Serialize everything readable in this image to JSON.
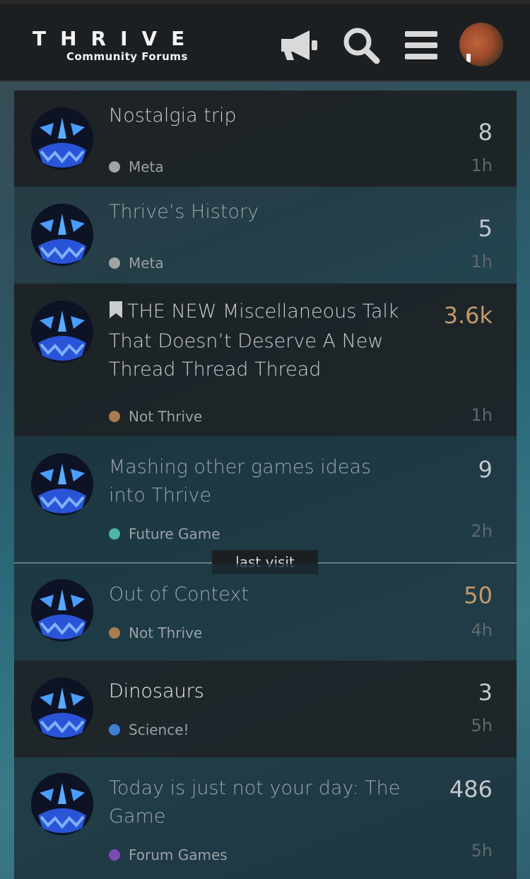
{
  "header": {
    "logo_main": "THRIVE",
    "logo_sub": "Community Forums",
    "icons": [
      "megaphone-icon",
      "search-icon",
      "hamburger-menu-icon",
      "user-avatar"
    ]
  },
  "colors": {
    "header_bg": "#1c1f22",
    "meta": "#a3a3a3",
    "not_thrive": "#a97c50",
    "future_game": "#4fb6a4",
    "science": "#3f7fd6",
    "forum_games": "#7d4bb3",
    "hot_count": "#c59a6a"
  },
  "topics": [
    {
      "title": "Nostalgia trip",
      "category": "Meta",
      "count": "8",
      "time": "1h"
    },
    {
      "title": "Thrive’s History",
      "category": "Meta",
      "count": "5",
      "time": "1h"
    },
    {
      "title": "THE NEW Miscellaneous Talk That Doesn’t Deserve A New Thread Thread Thread",
      "category": "Not Thrive",
      "count": "3.6k",
      "time": "1h"
    },
    {
      "title": "Mashing other games ideas into Thrive",
      "category": "Future Game",
      "count": "9",
      "time": "2h"
    },
    {
      "title": "Out of Context",
      "category": "Not Thrive",
      "count": "50",
      "time": "4h"
    },
    {
      "title": "Dinosaurs",
      "category": "Science!",
      "count": "3",
      "time": "5h"
    },
    {
      "title": "Today is just not your day: The Game",
      "category": "Forum Games",
      "count": "486",
      "time": "5h"
    }
  ],
  "last_visit_label": "last visit"
}
